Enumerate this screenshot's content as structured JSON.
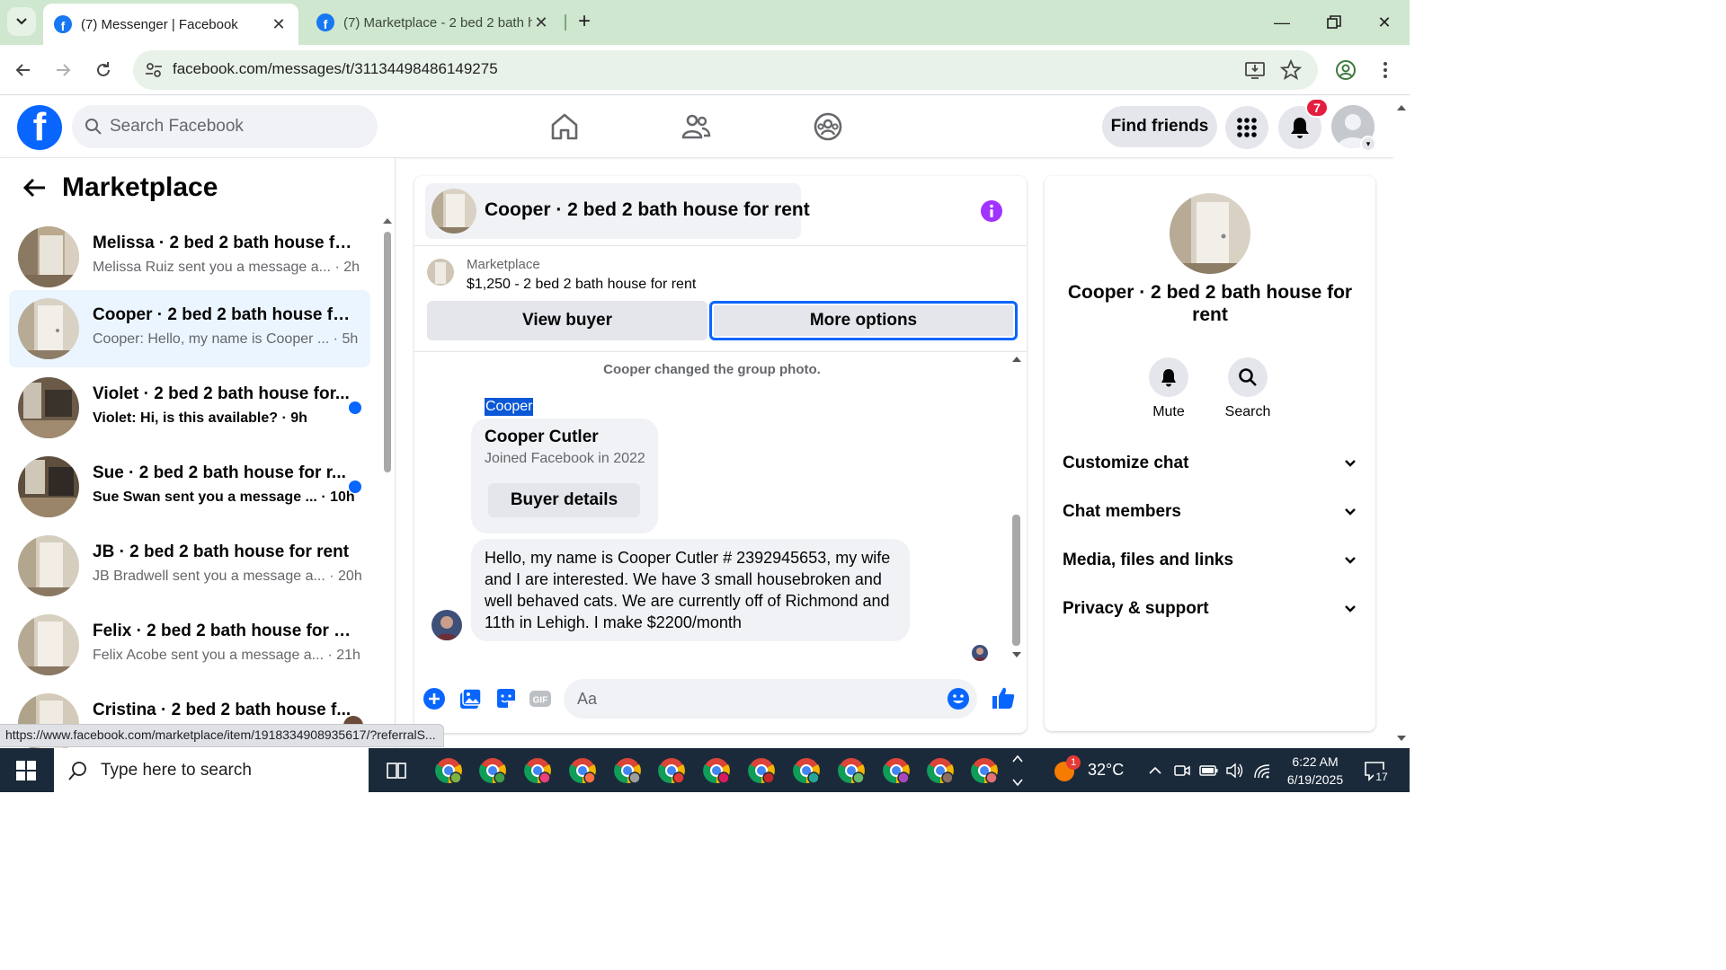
{
  "browser": {
    "tabs": [
      {
        "title": "(7) Messenger | Facebook",
        "active": true
      },
      {
        "title": "(7) Marketplace - 2 bed 2 bath h",
        "active": false
      }
    ],
    "new_tab": "+",
    "url": "facebook.com/messages/t/31134498486149275",
    "status_url": "https://www.facebook.com/marketplace/item/1918334908935617/?referralS..."
  },
  "fb_header": {
    "search_placeholder": "Search Facebook",
    "find_friends": "Find friends",
    "notification_count": "7"
  },
  "left_pane": {
    "title": "Marketplace",
    "conversations": [
      {
        "name": "Melissa · 2 bed 2 bath house for...",
        "preview": "Melissa Ruiz sent you a message a... · 2h",
        "unread": false,
        "selected": false
      },
      {
        "name": "Cooper · 2 bed 2 bath house for...",
        "preview": "Cooper: Hello, my name is Cooper ... · 5h",
        "unread": false,
        "selected": true
      },
      {
        "name": "Violet · 2 bed 2 bath house for...",
        "preview": "Violet: Hi, is this available? · 9h",
        "unread": true,
        "selected": false
      },
      {
        "name": "Sue · 2 bed 2 bath house for r...",
        "preview": "Sue Swan sent you a message ... · 10h",
        "unread": true,
        "selected": false
      },
      {
        "name": "JB · 2 bed 2 bath house for rent",
        "preview": "JB Bradwell sent you a message a... · 20h",
        "unread": false,
        "selected": false
      },
      {
        "name": "Felix · 2 bed 2 bath house for rent",
        "preview": "Felix Acobe sent you a message a... · 21h",
        "unread": false,
        "selected": false
      },
      {
        "name": "Cristina · 2 bed 2 bath house f...",
        "preview": "",
        "unread": false,
        "selected": false
      }
    ]
  },
  "chat": {
    "title": "Cooper · 2 bed 2 bath house for rent",
    "listing_label": "Marketplace",
    "listing_price": "$1,250 - 2 bed 2 bath house for rent",
    "view_buyer": "View buyer",
    "more_options": "More options",
    "system_message": "Cooper changed the group photo.",
    "sender_label": "Cooper",
    "card": {
      "name": "Cooper Cutler",
      "joined": "Joined Facebook in 2022",
      "button": "Buyer details"
    },
    "message": "Hello, my name is Cooper Cutler # 2392945653, my wife and I are interested. We have 3 small housebroken and well behaved cats. We are currently off of Richmond and 11th in Lehigh. I make $2200/month",
    "composer_placeholder": "Aa"
  },
  "info_pane": {
    "title": "Cooper · 2 bed 2 bath house for rent",
    "mute": "Mute",
    "search": "Search",
    "sections": [
      "Customize chat",
      "Chat members",
      "Media, files and links",
      "Privacy & support"
    ]
  },
  "taskbar": {
    "search_placeholder": "Type here to search",
    "weather": "32°C",
    "weather_badge": "1",
    "time": "6:22 AM",
    "date": "6/19/2025",
    "notification_count": "17"
  },
  "colors": {
    "fb_blue": "#0866ff",
    "selected_row": "#ebf5ff",
    "notif_red": "#e41e3f",
    "info_purple": "#a033ff",
    "tab_strip": "#cfe6cf"
  }
}
